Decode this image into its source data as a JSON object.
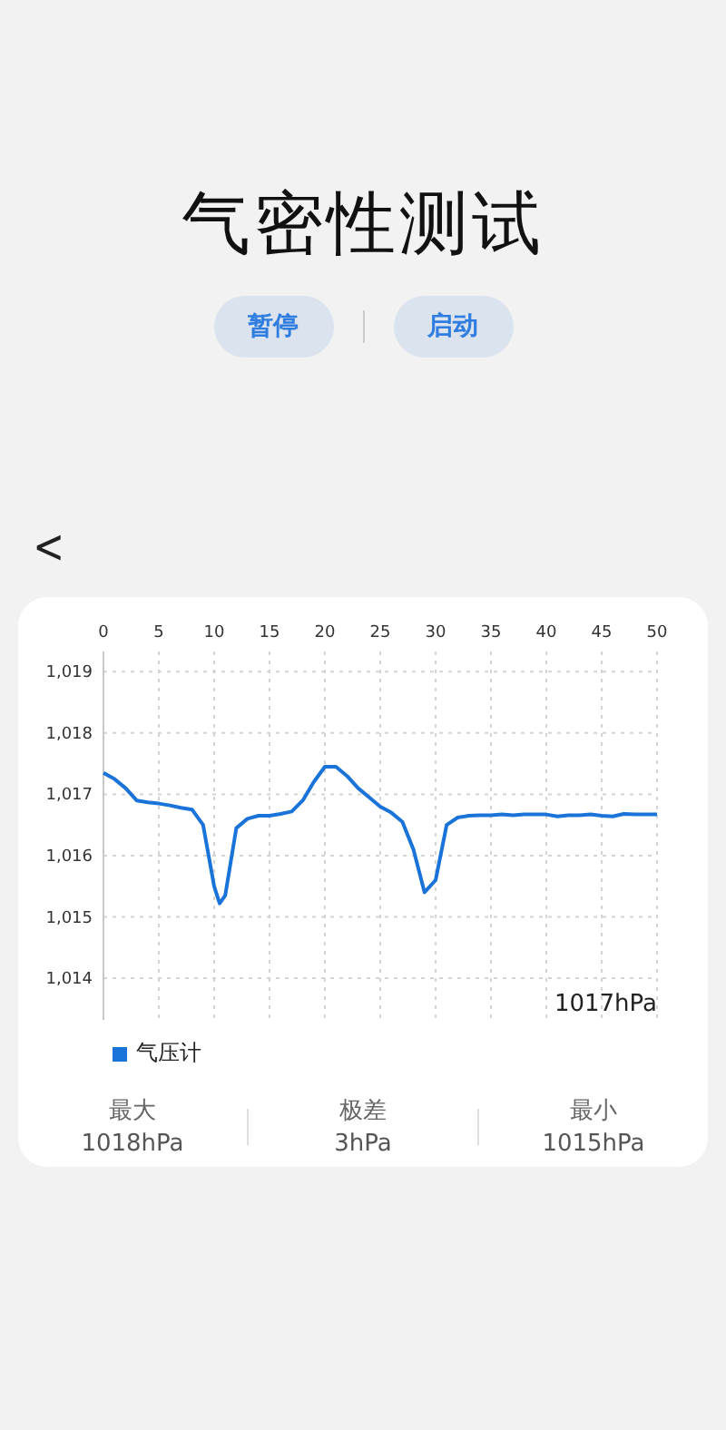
{
  "title": "气密性测试",
  "buttons": [
    {
      "label": "暂停"
    },
    {
      "label": "启动"
    }
  ],
  "back": {
    "label": "<"
  },
  "chart": {
    "reading": "1017hPa",
    "chart_data": {
      "type": "line",
      "x": [
        0,
        1,
        2,
        3,
        4,
        5,
        6,
        7,
        8,
        9,
        10,
        10.5,
        11,
        12,
        13,
        14,
        15,
        16,
        17,
        18,
        19,
        20,
        21,
        22,
        23,
        24,
        25,
        26,
        27,
        28,
        29,
        30,
        31,
        32,
        33,
        34,
        35,
        36,
        37,
        38,
        39,
        40,
        41,
        42,
        43,
        44,
        45,
        46,
        47,
        48,
        49,
        50
      ],
      "series": [
        {
          "name": "气压计",
          "color": "#1a73d9",
          "values": [
            1017.35,
            1017.25,
            1017.1,
            1016.9,
            1016.87,
            1016.85,
            1016.82,
            1016.78,
            1016.75,
            1016.5,
            1015.5,
            1015.22,
            1015.35,
            1016.45,
            1016.6,
            1016.65,
            1016.65,
            1016.68,
            1016.72,
            1016.9,
            1017.2,
            1017.45,
            1017.45,
            1017.3,
            1017.1,
            1016.95,
            1016.8,
            1016.7,
            1016.55,
            1016.1,
            1015.4,
            1015.6,
            1016.5,
            1016.62,
            1016.65,
            1016.66,
            1016.66,
            1016.67,
            1016.66,
            1016.67,
            1016.67,
            1016.67,
            1016.64,
            1016.66,
            1016.66,
            1016.67,
            1016.65,
            1016.64,
            1016.68,
            1016.67,
            1016.67,
            1016.67
          ]
        }
      ],
      "grid": true,
      "xlim": [
        0,
        50
      ],
      "ylim": [
        1013.32,
        1019.33
      ],
      "xticks": [
        0,
        5,
        10,
        15,
        20,
        25,
        30,
        35,
        40,
        45,
        50
      ],
      "yticks": [
        {
          "value": 1014,
          "label": "1,014"
        },
        {
          "value": 1015,
          "label": "1,015"
        },
        {
          "value": 1016,
          "label": "1,016"
        },
        {
          "value": 1017,
          "label": "1,017"
        },
        {
          "value": 1018,
          "label": "1,018"
        },
        {
          "value": 1019,
          "label": "1,019"
        }
      ]
    }
  },
  "stats": [
    {
      "label": "最大",
      "value": "1018hPa"
    },
    {
      "label": "极差",
      "value": "3hPa"
    },
    {
      "label": "最小",
      "value": "1015hPa"
    }
  ]
}
